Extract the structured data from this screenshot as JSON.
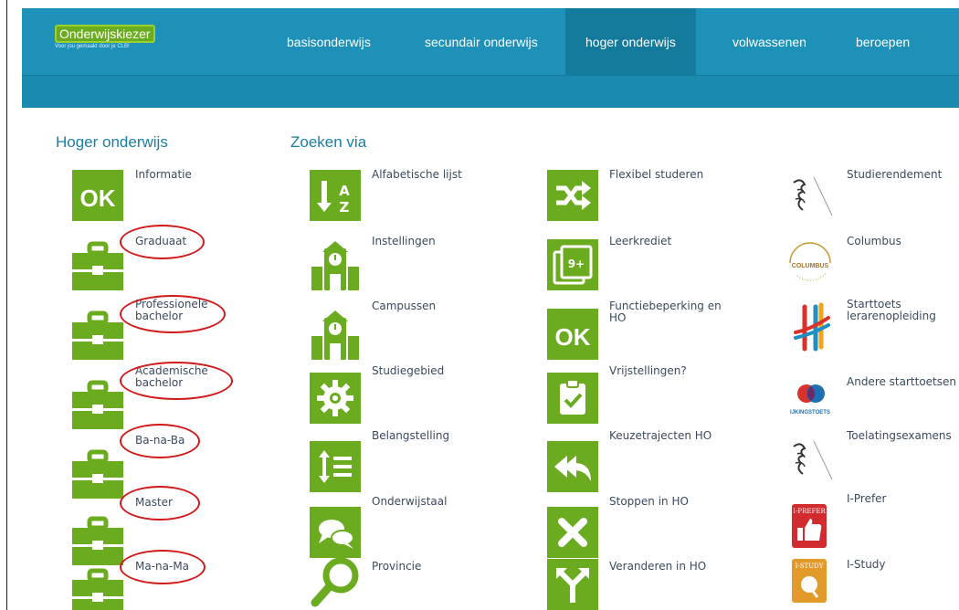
{
  "logo": {
    "title": "Onderwijskiezer",
    "tagline": "Voor jou gemaakt door je CLB!"
  },
  "nav": [
    "basisonderwijs",
    "secundair onderwijs",
    "hoger onderwijs",
    "volwassenen",
    "beroepen"
  ],
  "sections": {
    "left_title": "Hoger onderwijs",
    "right_title": "Zoeken via"
  },
  "col1": [
    "Informatie",
    "Graduaat",
    "Professionele\nbachelor",
    "Academische\nbachelor",
    "Ba-na-Ba",
    "Master",
    "Ma-na-Ma"
  ],
  "col2": [
    "Alfabetische lijst",
    "Instellingen",
    "Campussen",
    "Studiegebied",
    "Belangstelling",
    "Onderwijstaal",
    "Provincie"
  ],
  "col3": [
    "Flexibel studeren",
    "Leerkrediet",
    "Functiebeperking en\nHO",
    "Vrijstellingen?",
    "Keuzetrajecten HO",
    "Stoppen in HO",
    "Veranderen in HO"
  ],
  "col4": [
    "Studierendement",
    "Columbus",
    "Starttoets\nlerarenopleiding",
    "Andere starttoetsen",
    "Toelatingsexamens",
    "I-Prefer",
    "I-Study"
  ],
  "badges": {
    "ok": "OK",
    "columbus": "COLUMBUS",
    "ijkingstoets": "IJKINGSTOETS",
    "iprefer": "I-PREFER",
    "istudy": "I-STUDY",
    "nine_plus": "9+"
  },
  "colors": {
    "green": "#6bab1f",
    "header": "#1d91b8",
    "accent_text": "#1a7ea5",
    "annotation": "#d01919"
  }
}
